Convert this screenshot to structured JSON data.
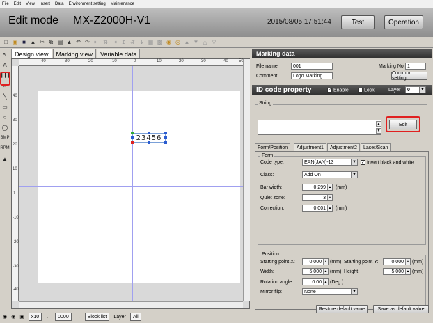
{
  "menu": [
    "File",
    "Edit",
    "View",
    "Insert",
    "Data",
    "Environment setting",
    "Maintenance"
  ],
  "header": {
    "mode": "Edit mode",
    "model": "MX-Z2000H-V1",
    "datetime": "2015/08/05 17:51:44",
    "test_label": "Test",
    "operation_label": "Operation"
  },
  "view_tabs": [
    "Design view",
    "Marking view",
    "Variable data"
  ],
  "canvas": {
    "barcode_text": "23456",
    "ruler_top": [
      "-40",
      "-30",
      "-20",
      "-10",
      "0",
      "10",
      "20",
      "30",
      "40",
      "50"
    ],
    "ruler_left": [
      "40",
      "30",
      "20",
      "10",
      "0",
      "-10",
      "-20",
      "-30",
      "-40"
    ]
  },
  "bottombar": {
    "zoom": "x10",
    "field_value": "0000",
    "block_list_label": "Block list",
    "layer_label": "Layer",
    "layer_value": "All"
  },
  "marking_data": {
    "title": "Marking data",
    "file_name_label": "File name",
    "file_name": "001",
    "marking_no_label": "Marking No.",
    "marking_no": "1",
    "comment_label": "Comment",
    "comment": "Logo Marking",
    "common_setting_label": "Common setting"
  },
  "id_code": {
    "title": "ID code property",
    "enable_label": "Enable",
    "lock_label": "Lock",
    "layer_label": "Layer",
    "layer_value": "0",
    "string_label": "String",
    "string_value": "",
    "edit_label": "Edit"
  },
  "subtabs": [
    "Form/Position",
    "Adjustment1",
    "Adjustment2",
    "Laser/Scan"
  ],
  "form": {
    "group_label": "Form",
    "code_type_label": "Code type:",
    "code_type": "EAN(JAN)-13",
    "invert_label": "Invert black and white",
    "class_label": "Class:",
    "class_value": "Add On",
    "bar_width_label": "Bar width:",
    "bar_width": "0.299",
    "quiet_zone_label": "Quiet zone:",
    "quiet_zone": "3",
    "correction_label": "Correction:",
    "correction": "0.001",
    "unit_mm": "(mm)"
  },
  "position": {
    "group_label": "Position",
    "start_x_label": "Starting point X:",
    "start_x": "0.000",
    "start_y_label": "Starting point Y:",
    "start_y": "0.000",
    "width_label": "Width:",
    "width": "5.000",
    "height_label": "Height",
    "height": "5.000",
    "rotation_label": "Rotation angle",
    "rotation": "0.00",
    "deg": "(Deg.)",
    "mirror_label": "Mirror flip:",
    "mirror_value": "None",
    "unit_mm": "(mm)"
  },
  "footer": {
    "restore_label": "Restore default value",
    "save_label": "Save as default value"
  },
  "icons": {
    "lefttools": [
      "select-arrow-icon",
      "a-text-icon",
      "barcode-icon",
      "cross-icon",
      "line-icon",
      "rectangle-icon",
      "circle-icon",
      "polygon-icon",
      "bmp-icon",
      "rpm-icon",
      "import-icon"
    ]
  },
  "accent": {
    "highlight": "#e02020",
    "header_dark": "#2e2e2e"
  }
}
